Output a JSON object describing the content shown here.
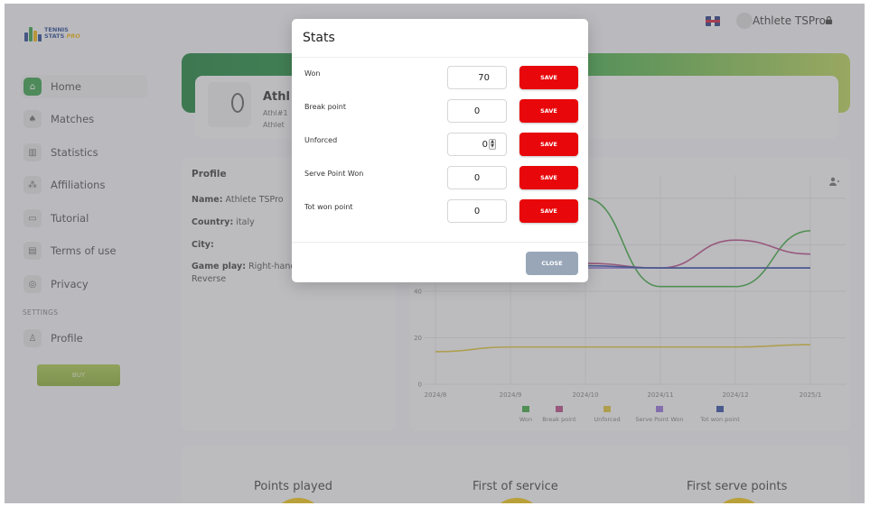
{
  "app": {
    "logo_line1": "TENNIS",
    "logo_line2": "STATS",
    "logo_line3": "PRO"
  },
  "header": {
    "user_name": "Athlete TSPro",
    "flag_icon": "uk-flag-icon",
    "lock_icon": "lock-icon"
  },
  "sidebar": {
    "items": [
      {
        "label": "Home",
        "icon": "home-icon",
        "active": true
      },
      {
        "label": "Matches",
        "icon": "racket-icon"
      },
      {
        "label": "Statistics",
        "icon": "bar-chart-icon"
      },
      {
        "label": "Affiliations",
        "icon": "affiliations-icon"
      },
      {
        "label": "Tutorial",
        "icon": "tutorial-icon"
      },
      {
        "label": "Terms of use",
        "icon": "document-icon"
      },
      {
        "label": "Privacy",
        "icon": "privacy-icon"
      }
    ],
    "settings_label": "SETTINGS",
    "profile_label": "Profile",
    "buy_label": "BUY"
  },
  "profile_card": {
    "name_partial": "Athl",
    "line1_partial": "Athl#1",
    "line2_partial": "Athlet"
  },
  "info": {
    "title": "Profile",
    "name_label": "Name:",
    "name_value": "Athlete TSPro",
    "country_label": "Country:",
    "country_value": "italy",
    "city_label": "City:",
    "gameplay_label": "Game play:",
    "gameplay_value": "Right-hand",
    "gameplay_value2": "Reverse"
  },
  "chart_data": {
    "type": "line",
    "x": [
      "2024/8",
      "2024/9",
      "2024/10",
      "2024/11",
      "2024/12",
      "2025/1"
    ],
    "y_ticks_visible": [
      0,
      20,
      40
    ],
    "series": [
      {
        "name": "Won",
        "color": "#33a532",
        "values_visible": [
          null,
          null,
          80,
          42,
          42,
          66
        ]
      },
      {
        "name": "Break point",
        "color": "#b43f7d",
        "values_visible": [
          null,
          null,
          52,
          50,
          62,
          56
        ]
      },
      {
        "name": "Unforced",
        "color": "#e0c02c",
        "values": [
          14,
          16,
          16,
          16,
          16,
          17
        ]
      },
      {
        "name": "Serve Point Won",
        "color": "#8e6ad8",
        "values_visible": [
          null,
          null,
          50,
          50,
          50,
          50
        ]
      },
      {
        "name": "Tot won point",
        "color": "#23449c",
        "values_visible": [
          null,
          null,
          51,
          50,
          50,
          50
        ]
      }
    ]
  },
  "bottom": {
    "points_played": "Points played",
    "first_of_service": "First of service",
    "first_serve_points": "First serve points"
  },
  "modal": {
    "title": "Stats",
    "rows": [
      {
        "label": "Won",
        "value": "70",
        "save": "SAVE"
      },
      {
        "label": "Break point",
        "value": "0",
        "save": "SAVE"
      },
      {
        "label": "Unforced",
        "value": "0",
        "save": "SAVE"
      },
      {
        "label": "Serve Point Won",
        "value": "0",
        "save": "SAVE"
      },
      {
        "label": "Tot won point",
        "value": "0",
        "save": "SAVE"
      }
    ],
    "close_label": "CLOSE"
  }
}
